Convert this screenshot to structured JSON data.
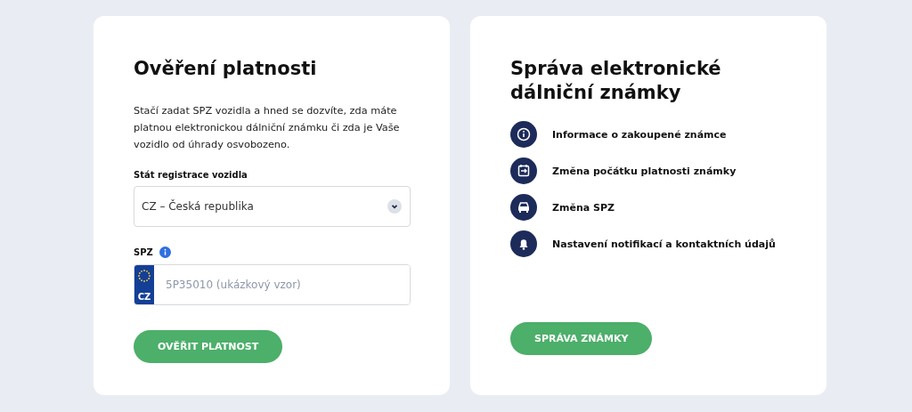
{
  "check_card": {
    "title": "Ověření platnosti",
    "description": "Stačí zadat SPZ vozidla a hned se dozvíte, zda máte platnou elektronickou dálniční známku či zda je Vaše vozidlo od úhrady osvobozeno.",
    "country_label": "Stát registrace vozidla",
    "country_value": "CZ – Česká republika",
    "plate_label": "SPZ",
    "plate_code": "CZ",
    "plate_placeholder": "5P35010 (ukázkový vzor)",
    "button": "OVĚŘIT PLATNOST"
  },
  "manage_card": {
    "title": "Správa elektronické dálniční známky",
    "items": [
      {
        "kind": "info",
        "label": "Informace o zakoupené známce"
      },
      {
        "kind": "calendar",
        "label": "Změna počátku platnosti známky"
      },
      {
        "kind": "car",
        "label": "Změna SPZ"
      },
      {
        "kind": "bell",
        "label": "Nastavení notifikací a kontaktních údajů"
      }
    ],
    "button": "SPRÁVA ZNÁMKY"
  }
}
